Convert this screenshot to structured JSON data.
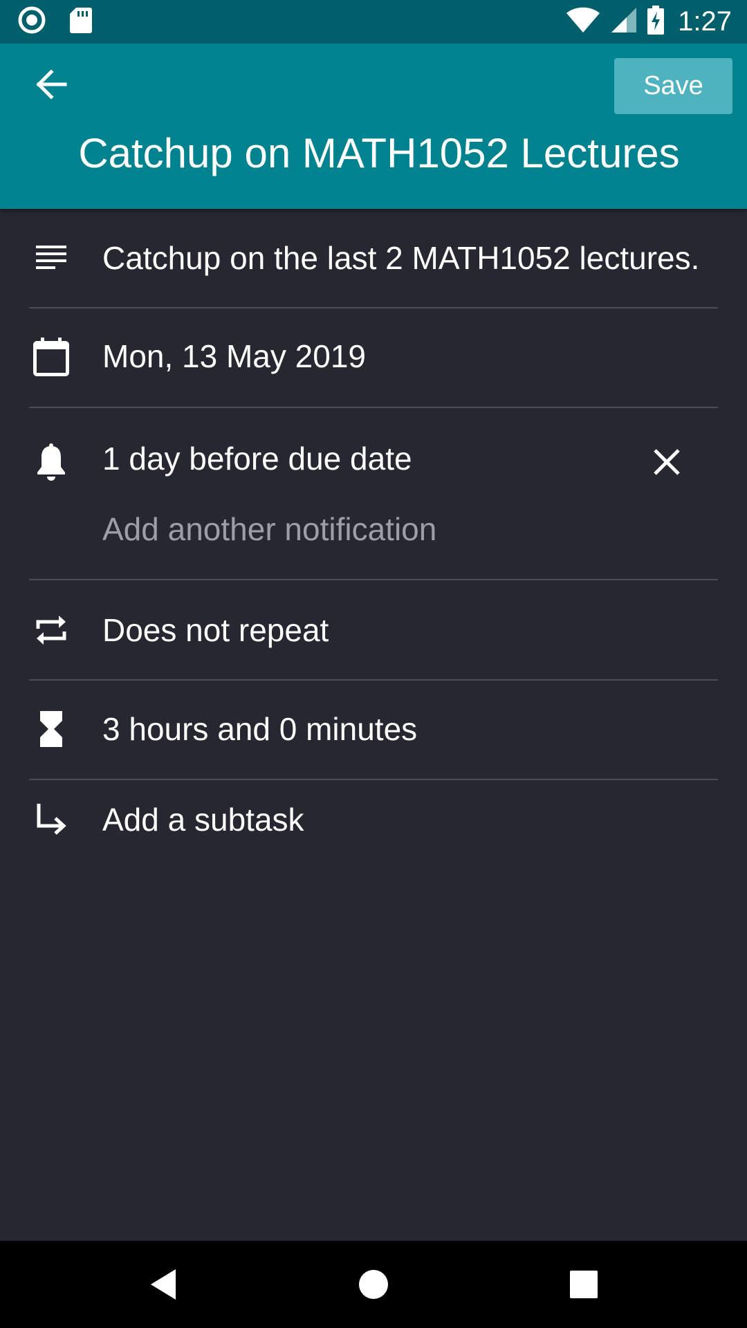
{
  "status_bar": {
    "time": "1:27",
    "left_icons": [
      "radio-icon",
      "sd-card-icon"
    ],
    "right_icons": [
      "wifi-icon",
      "cell-signal-icon",
      "battery-charging-icon"
    ]
  },
  "app_bar": {
    "title": "Catchup on MATH1052 Lectures",
    "save_label": "Save",
    "back_icon": "arrow-back-icon",
    "colors": {
      "primary": "#00838f",
      "status": "#005f6b",
      "save_bg": "#4fb3bf"
    }
  },
  "task": {
    "description": "Catchup on the last 2 MATH1052 lectures.",
    "due_date": "Mon, 13 May 2019",
    "notification": "1 day before due date",
    "add_notification": "Add another notification",
    "repeat": "Does not repeat",
    "duration": "3 hours and 0 minutes",
    "add_subtask": "Add a subtask"
  },
  "icons": {
    "description": "notes-icon",
    "date": "calendar-icon",
    "notification": "bell-icon",
    "remove": "close-icon",
    "repeat": "repeat-icon",
    "duration": "hourglass-icon",
    "subtask": "subdirectory-arrow-icon"
  },
  "nav_bar": [
    "back-triangle-icon",
    "home-circle-icon",
    "recents-square-icon"
  ]
}
